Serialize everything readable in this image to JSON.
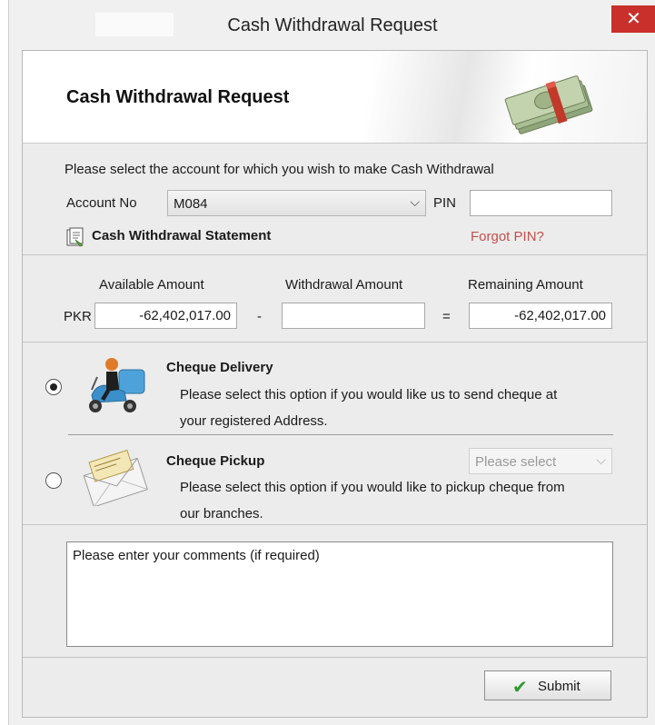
{
  "window": {
    "title": "Cash Withdrawal Request",
    "close_glyph": "✕"
  },
  "header": {
    "title": "Cash Withdrawal Request",
    "icon": "money-bundle-icon"
  },
  "account_section": {
    "instruction": "Please select the account for which you wish to make Cash Withdrawal",
    "account_label": "Account No",
    "account_value": "M084",
    "pin_label": "PIN",
    "pin_value": "",
    "statement_link": "Cash Withdrawal Statement",
    "forgot_pin_link": "Forgot PIN?"
  },
  "amounts": {
    "available_label": "Available Amount",
    "withdrawal_label": "Withdrawal Amount",
    "remaining_label": "Remaining Amount",
    "currency": "PKR",
    "available_value": "-62,402,017.00",
    "withdrawal_value": "",
    "remaining_value": "-62,402,017.00",
    "minus": "-",
    "equals": "="
  },
  "delivery_options": {
    "selected": "cheque_delivery",
    "cheque_delivery": {
      "title": "Cheque Delivery",
      "line1": "Please select this option if you would like us to send cheque at",
      "line2": "your registered Address."
    },
    "cheque_pickup": {
      "title": "Cheque Pickup",
      "line1": "Please select this option if you would like to pickup cheque from",
      "line2": "our branches.",
      "branch_placeholder": "Please select"
    }
  },
  "comments": {
    "placeholder": "Please enter your comments (if required)"
  },
  "footer": {
    "submit_label": "Submit"
  },
  "colors": {
    "close_button": "#c9302c",
    "link_red": "#c0504d",
    "submit_check": "#2e9a2e"
  }
}
